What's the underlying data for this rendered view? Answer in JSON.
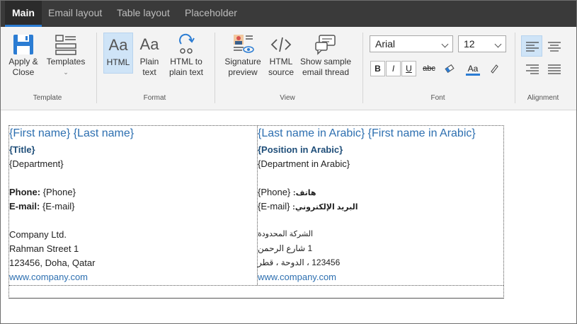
{
  "tabs": [
    {
      "label": "Main",
      "active": true
    },
    {
      "label": "Email layout",
      "active": false
    },
    {
      "label": "Table layout",
      "active": false
    },
    {
      "label": "Placeholder",
      "active": false
    }
  ],
  "ribbon": {
    "template": {
      "group_label": "Template",
      "apply_close_line1": "Apply &",
      "apply_close_line2": "Close",
      "templates_label": "Templates"
    },
    "format": {
      "group_label": "Format",
      "html_label": "HTML",
      "plain_text_line1": "Plain",
      "plain_text_line2": "text",
      "html_to_plain_line1": "HTML to",
      "html_to_plain_line2": "plain text"
    },
    "view": {
      "group_label": "View",
      "sig_preview_line1": "Signature",
      "sig_preview_line2": "preview",
      "html_source_line1": "HTML",
      "html_source_line2": "source",
      "sample_thread_line1": "Show sample",
      "sample_thread_line2": "email thread"
    },
    "font": {
      "group_label": "Font",
      "font_family": "Arial",
      "font_size": "12",
      "bold": "B",
      "italic": "I",
      "underline": "U",
      "strike": "abc",
      "font_color_label": "Aa"
    },
    "alignment": {
      "group_label": "Alignment"
    },
    "accent_color": "#2b7cd3"
  },
  "signature": {
    "left": {
      "name": "{First name} {Last name}",
      "title": "{Title}",
      "department": "{Department}",
      "phone_label": "Phone:",
      "phone_value": "{Phone}",
      "email_label": "E-mail:",
      "email_value": "{E-mail}",
      "company": "Company Ltd.",
      "street": "Rahman Street 1",
      "city": "123456, Doha, Qatar",
      "website": "www.company.com"
    },
    "right": {
      "name": "{Last name in Arabic} {First name in Arabic}",
      "title": "{Position in Arabic}",
      "department": "{Department in Arabic}",
      "phone_value": "{Phone}",
      "phone_label": "هاتف:",
      "email_value": "{E-mail}",
      "email_label": "البريد الإلكتروني:",
      "company": "الشركة المحدودة",
      "street": "1 شارع الرحمن",
      "city": "123456 ، الدوحة ، قطر",
      "website": "www.company.com"
    }
  }
}
